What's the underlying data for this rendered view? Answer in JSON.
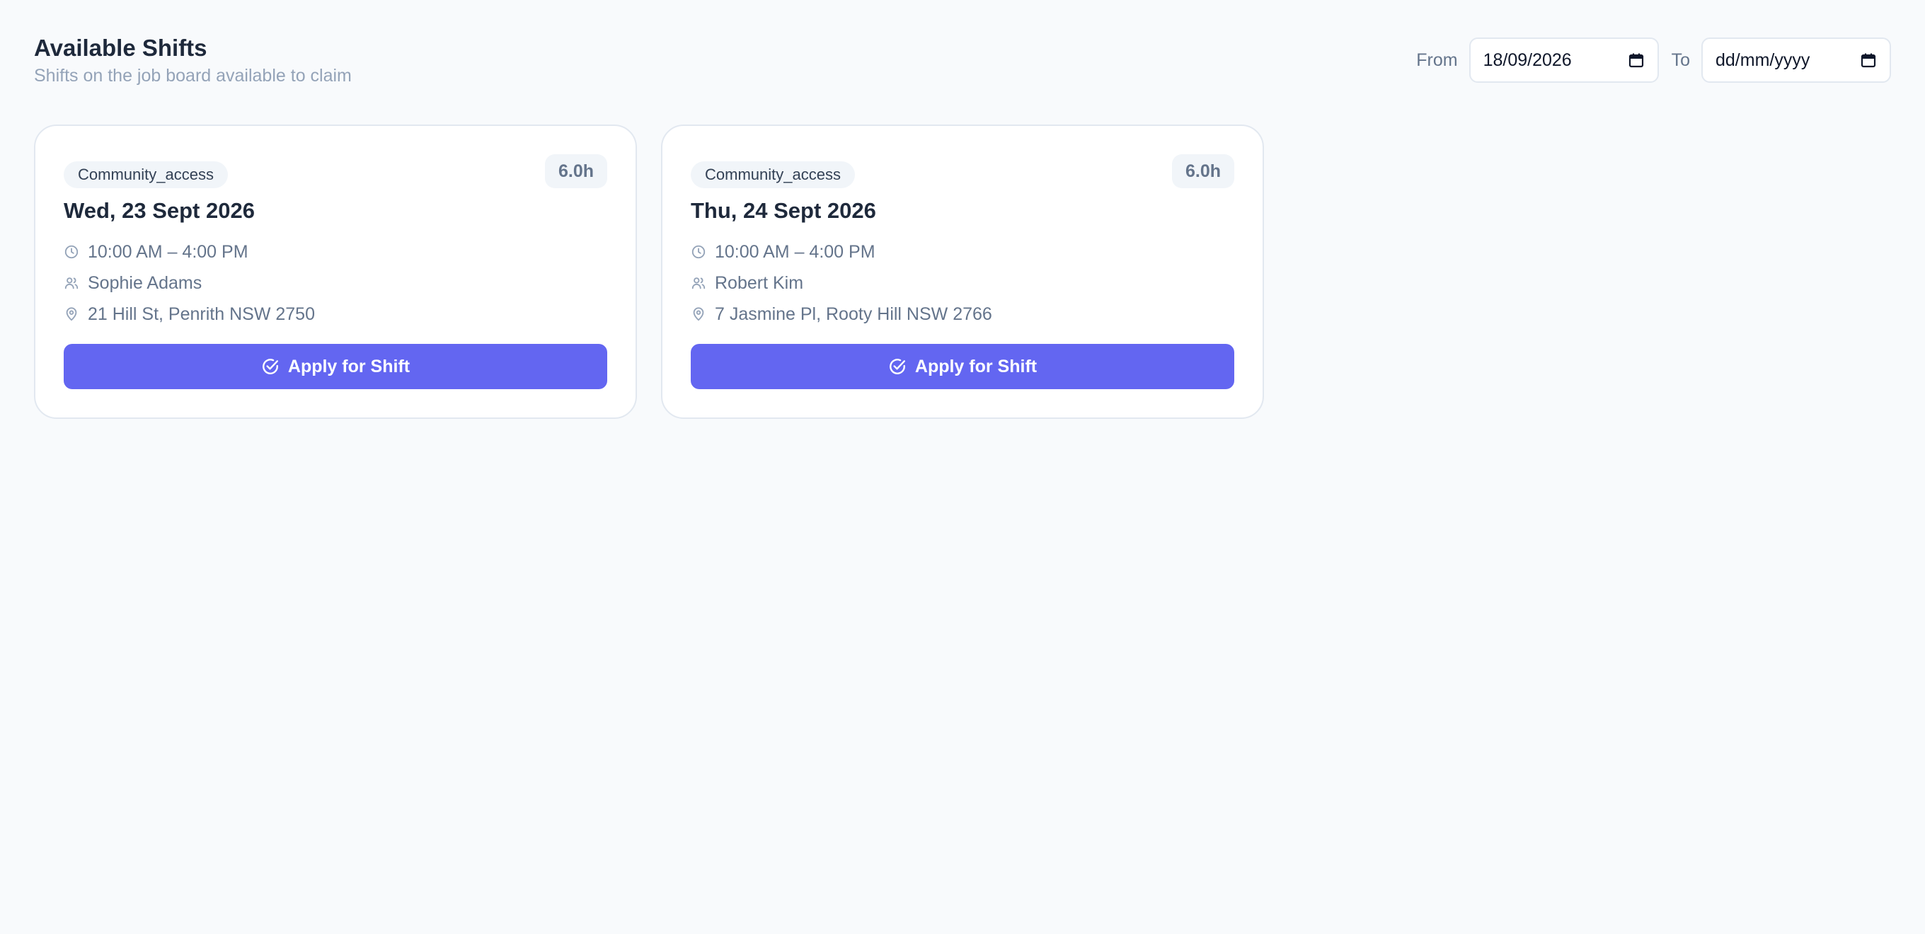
{
  "header": {
    "title": "Available Shifts",
    "subtitle": "Shifts on the job board available to claim"
  },
  "filters": {
    "from_label": "From",
    "from_value": "18/09/2026",
    "to_label": "To",
    "to_value": "dd/mm/yyyy"
  },
  "icons": {
    "calendar": "calendar-icon",
    "clock": "clock-icon",
    "client": "users-icon",
    "location": "map-pin-icon",
    "apply": "check-circle-icon"
  },
  "colors": {
    "accent": "#6366f1",
    "background": "#f8fafc"
  },
  "shifts": [
    {
      "type": "Community_access",
      "hours": "6.0h",
      "date": "Wed, 23 Sept 2026",
      "time": "10:00 AM – 4:00 PM",
      "client": "Sophie Adams",
      "address": "21 Hill St, Penrith NSW 2750",
      "button_label": "Apply for Shift"
    },
    {
      "type": "Community_access",
      "hours": "6.0h",
      "date": "Thu, 24 Sept 2026",
      "time": "10:00 AM – 4:00 PM",
      "client": "Robert Kim",
      "address": "7 Jasmine Pl, Rooty Hill NSW 2766",
      "button_label": "Apply for Shift"
    }
  ]
}
